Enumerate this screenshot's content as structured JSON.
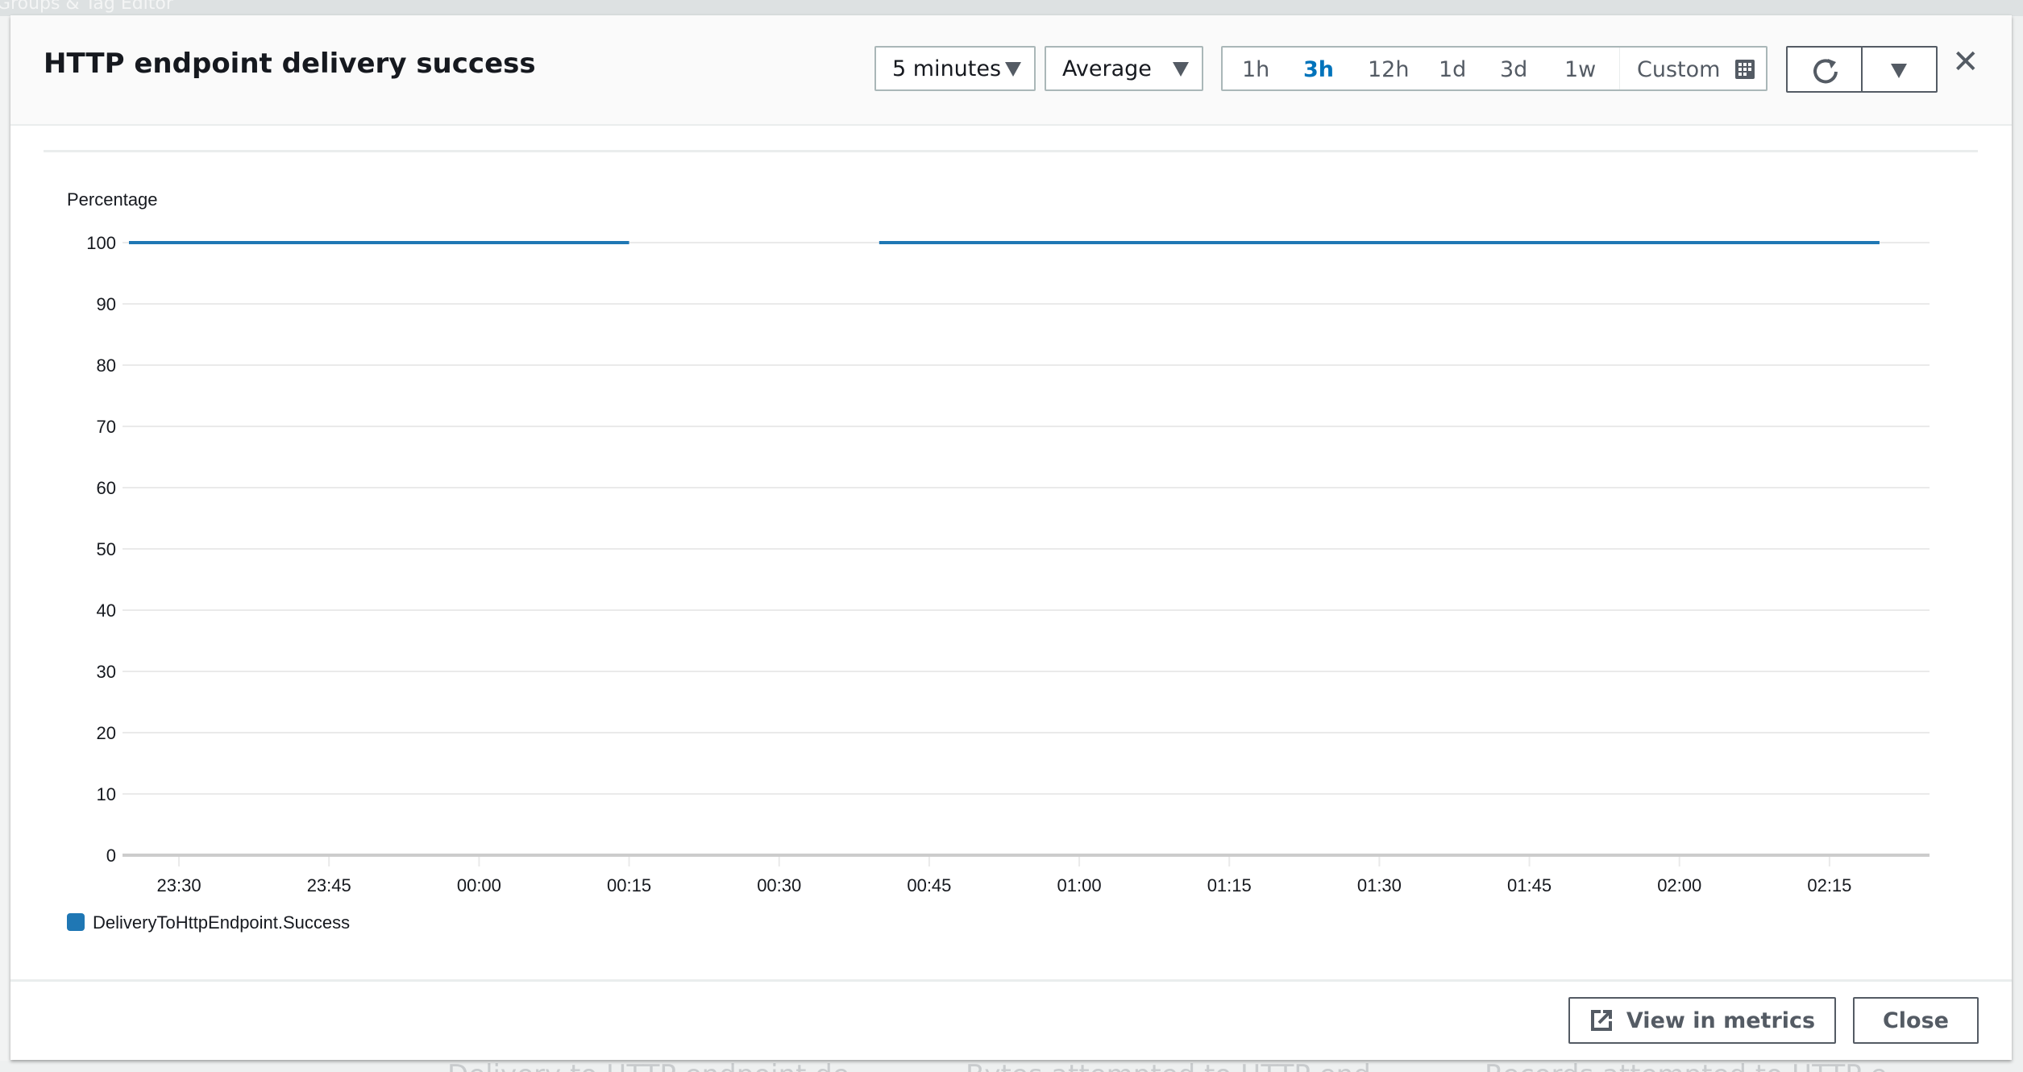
{
  "background": {
    "top_text": "Groups & Tag Editor",
    "bottom_texts": [
      "Delivery to HTTP endpoint de...",
      "Bytes attempted to HTTP end...",
      "Records attempted to HTTP e..."
    ]
  },
  "modal": {
    "title": "HTTP endpoint delivery success",
    "period": {
      "selected": "5 minutes"
    },
    "statistic": {
      "selected": "Average"
    },
    "time_ranges": [
      {
        "label": "1h",
        "selected": false
      },
      {
        "label": "3h",
        "selected": true
      },
      {
        "label": "12h",
        "selected": false
      },
      {
        "label": "1d",
        "selected": false
      },
      {
        "label": "3d",
        "selected": false
      },
      {
        "label": "1w",
        "selected": false
      }
    ],
    "custom_label": "Custom",
    "icons": {
      "custom": "calendar-icon",
      "refresh": "refresh-icon",
      "menu": "caret-down-icon",
      "close": "close-icon",
      "external": "external-link-icon"
    },
    "footer": {
      "view_in_metrics": "View in metrics",
      "close": "Close"
    }
  },
  "chart_data": {
    "type": "line",
    "ylabel": "Percentage",
    "ylim": [
      0,
      100
    ],
    "yticks": [
      0,
      10,
      20,
      30,
      40,
      50,
      60,
      70,
      80,
      90,
      100
    ],
    "xlim": [
      "23:25",
      "02:25"
    ],
    "xticks": [
      "23:30",
      "23:45",
      "00:00",
      "00:15",
      "00:30",
      "00:45",
      "01:00",
      "01:15",
      "01:30",
      "01:45",
      "02:00",
      "02:15"
    ],
    "grid": true,
    "legend_position": "bottom-left",
    "series": [
      {
        "name": "DeliveryToHttpEndpoint.Success",
        "color": "#1f77b4",
        "segments": [
          {
            "from": "23:25",
            "to": "00:15",
            "interval_minutes": 5,
            "value": 100
          },
          {
            "from": "00:40",
            "to": "02:20",
            "interval_minutes": 5,
            "value": 100
          }
        ]
      }
    ]
  }
}
